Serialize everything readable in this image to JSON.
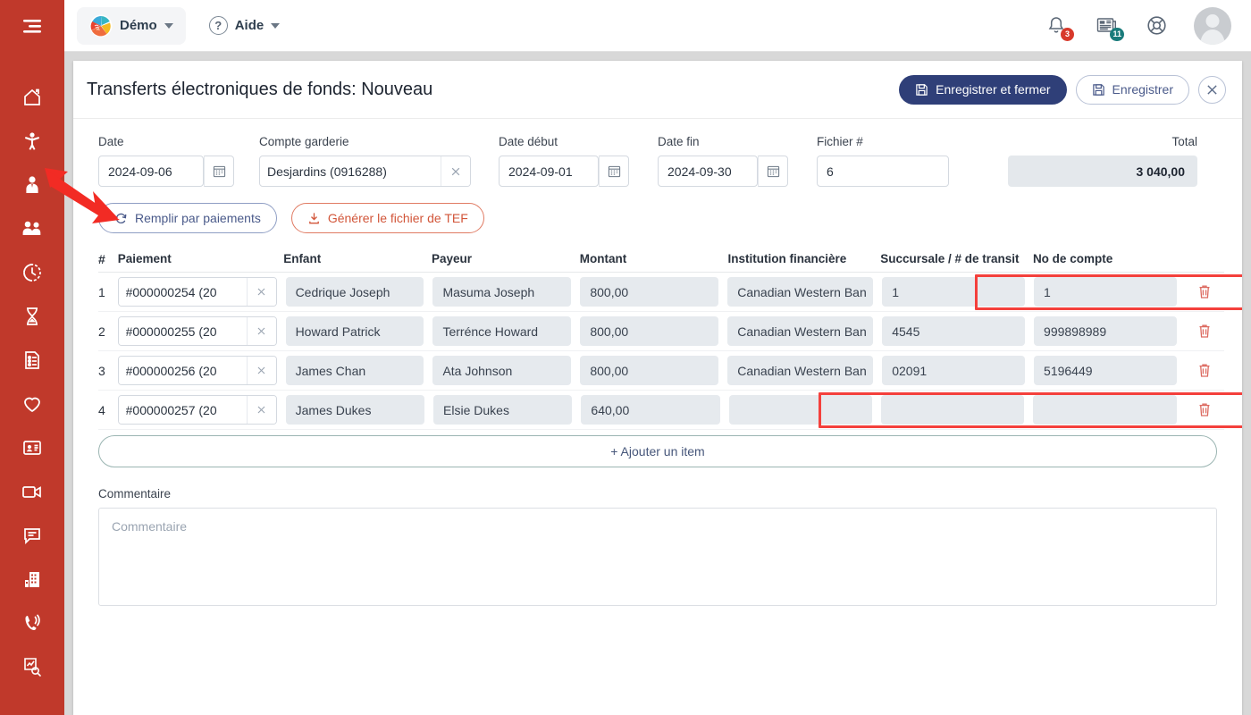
{
  "sidebar": {
    "toggle": "menu-toggle",
    "items": [
      {
        "icon": "home-icon",
        "name": "sidebar-item-home"
      },
      {
        "icon": "child-icon",
        "name": "sidebar-item-children"
      },
      {
        "icon": "employee-icon",
        "name": "sidebar-item-employees"
      },
      {
        "icon": "group-icon",
        "name": "sidebar-item-groups"
      },
      {
        "icon": "clock-icon",
        "name": "sidebar-item-attendance"
      },
      {
        "icon": "hourglass-icon",
        "name": "sidebar-item-waitlist"
      },
      {
        "icon": "form-icon",
        "name": "sidebar-item-forms"
      },
      {
        "icon": "heart-icon",
        "name": "sidebar-item-health"
      },
      {
        "icon": "id-card-icon",
        "name": "sidebar-item-contacts"
      },
      {
        "icon": "video-icon",
        "name": "sidebar-item-video"
      },
      {
        "icon": "chat-icon",
        "name": "sidebar-item-messages"
      },
      {
        "icon": "building-icon",
        "name": "sidebar-item-centers"
      },
      {
        "icon": "phone-icon",
        "name": "sidebar-item-calls"
      },
      {
        "icon": "report-search-icon",
        "name": "sidebar-item-reports"
      }
    ]
  },
  "topbar": {
    "org_label": "Démo",
    "help_label": "Aide",
    "notifications_badge": "3",
    "news_badge": "11",
    "support_icon": "lifebuoy-icon",
    "avatar": "user-avatar"
  },
  "page": {
    "title": "Transferts électroniques de fonds: Nouveau",
    "save_and_close_label": "Enregistrer et fermer",
    "save_label": "Enregistrer",
    "close_label": "×"
  },
  "form": {
    "date": {
      "label": "Date",
      "value": "2024-09-06"
    },
    "account": {
      "label": "Compte garderie",
      "value": "Desjardins (0916288)"
    },
    "date_start": {
      "label": "Date début",
      "value": "2024-09-01"
    },
    "date_end": {
      "label": "Date fin",
      "value": "2024-09-30"
    },
    "file_no": {
      "label": "Fichier #",
      "value": "6"
    },
    "total": {
      "label": "Total",
      "value": "3 040,00"
    }
  },
  "actions": {
    "fill_by_payments": "Remplir par paiements",
    "generate_eft_file": "Générer le fichier de TEF"
  },
  "table": {
    "headers": {
      "num": "#",
      "payment": "Paiement",
      "child": "Enfant",
      "payer": "Payeur",
      "amount": "Montant",
      "institution": "Institution financière",
      "branch": "Succursale / # de transit",
      "account": "No de compte"
    },
    "rows": [
      {
        "num": "1",
        "payment": "#000000254 (20",
        "child": "Cedrique Joseph",
        "payer": "Masuma Joseph",
        "amount": "800,00",
        "institution": "Canadian Western Ban",
        "branch": "1",
        "account": "1"
      },
      {
        "num": "2",
        "payment": "#000000255 (20",
        "child": "Howard Patrick",
        "payer": "Terrénce Howard",
        "amount": "800,00",
        "institution": "Canadian Western Ban",
        "branch": "4545",
        "account": "999898989"
      },
      {
        "num": "3",
        "payment": "#000000256 (20",
        "child": "James Chan",
        "payer": "Ata Johnson",
        "amount": "800,00",
        "institution": "Canadian Western Ban",
        "branch": "02091",
        "account": "5196449"
      },
      {
        "num": "4",
        "payment": "#000000257 (20",
        "child": "James Dukes",
        "payer": "Elsie Dukes",
        "amount": "640,00",
        "institution": "",
        "branch": "",
        "account": ""
      }
    ],
    "add_item_label": "+ Ajouter un item"
  },
  "comment": {
    "label": "Commentaire",
    "placeholder": "Commentaire",
    "value": ""
  },
  "colors": {
    "sidebar": "#c0392b",
    "primary_button": "#2f3f78",
    "highlight": "#f4403c",
    "accent_red": "#d2563a",
    "field_readonly": "#e6eaee"
  }
}
